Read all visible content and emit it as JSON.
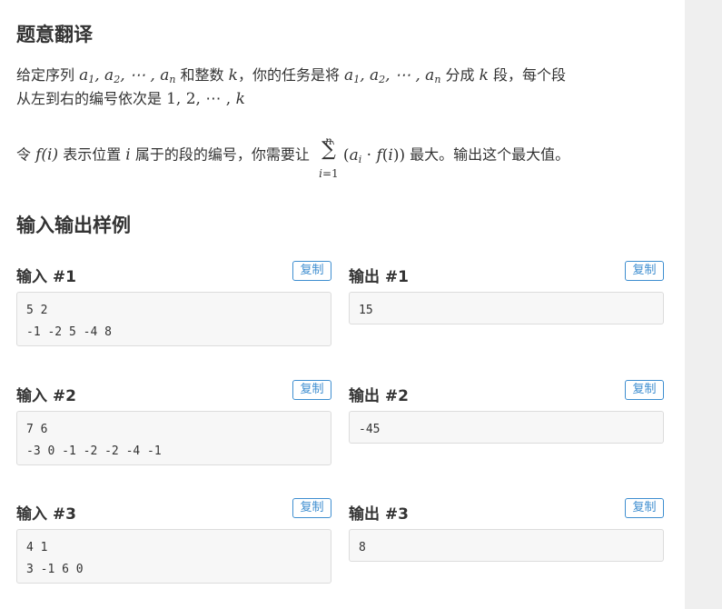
{
  "translation": {
    "heading": "题意翻译",
    "p1": {
      "t1": "给定序列 ",
      "t2": " 和整数 ",
      "t3": "，你的任务是将 ",
      "t4": " 分成 ",
      "t5": " 段，每个段"
    },
    "p2": {
      "t1": "从左到右的编号依次是 "
    },
    "p3": {
      "t1": "令 ",
      "t2": " 表示位置 ",
      "t3": " 属于的段的编号，你需要让 ",
      "t4": " 最大。输出这个最大值。"
    }
  },
  "samples": {
    "heading": "输入输出样例",
    "copy_label": "复制",
    "items": [
      {
        "input_label": "输入 #1",
        "output_label": "输出 #1",
        "input_lines": [
          "5 2",
          "-1 -2 5 -4 8"
        ],
        "output_lines": [
          "15"
        ]
      },
      {
        "input_label": "输入 #2",
        "output_label": "输出 #2",
        "input_lines": [
          "7 6",
          "-3 0 -1 -2 -2 -4 -1"
        ],
        "output_lines": [
          "-45"
        ]
      },
      {
        "input_label": "输入 #3",
        "output_label": "输出 #3",
        "input_lines": [
          "4 1",
          "3 -1 6 0"
        ],
        "output_lines": [
          "8"
        ]
      }
    ]
  }
}
